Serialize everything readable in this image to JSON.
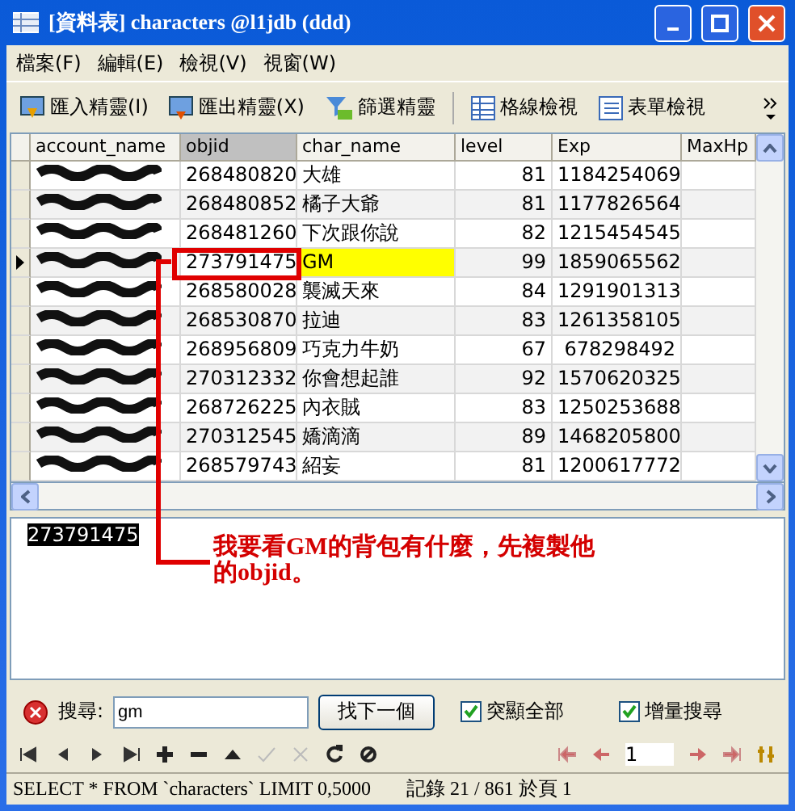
{
  "window": {
    "title": "[資料表] characters @l1jdb (ddd)"
  },
  "menu": [
    "檔案(F)",
    "編輯(E)",
    "檢視(V)",
    "視窗(W)"
  ],
  "toolbar": [
    {
      "label": "匯入精靈(I)",
      "kind": "import"
    },
    {
      "label": "匯出精靈(X)",
      "kind": "export"
    },
    {
      "label": "篩選精靈",
      "kind": "filter"
    },
    {
      "label": "格線檢視",
      "kind": "grid"
    },
    {
      "label": "表單檢視",
      "kind": "form"
    }
  ],
  "table": {
    "columns": [
      {
        "label": "account_name",
        "selected": false
      },
      {
        "label": "objid",
        "selected": true
      },
      {
        "label": "char_name",
        "selected": false
      },
      {
        "label": "level",
        "selected": false
      },
      {
        "label": "Exp",
        "selected": false
      },
      {
        "label": "MaxHp",
        "selected": false
      }
    ],
    "rows": [
      {
        "selected": false,
        "objid": "268480820",
        "char_name": "大雄",
        "level": "81",
        "exp": "1184254069",
        "match": false
      },
      {
        "selected": false,
        "objid": "268480852",
        "char_name": "橘子大爺",
        "level": "81",
        "exp": "1177826564",
        "match": false
      },
      {
        "selected": false,
        "objid": "268481260",
        "char_name": "下次跟你說",
        "level": "82",
        "exp": "1215454545",
        "match": false
      },
      {
        "selected": true,
        "objid": "273791475",
        "char_name": "GM",
        "level": "99",
        "exp": "1859065562",
        "match": true
      },
      {
        "selected": false,
        "objid": "268580028",
        "char_name": "襲滅天來",
        "level": "84",
        "exp": "1291901313",
        "match": false
      },
      {
        "selected": false,
        "objid": "268530870",
        "char_name": "拉迪",
        "level": "83",
        "exp": "1261358105",
        "match": false
      },
      {
        "selected": false,
        "objid": "268956809",
        "char_name": "巧克力牛奶",
        "level": "67",
        "exp": "678298492",
        "match": false
      },
      {
        "selected": false,
        "objid": "270312332",
        "char_name": "你會想起誰",
        "level": "92",
        "exp": "1570620325",
        "match": false
      },
      {
        "selected": false,
        "objid": "268726225",
        "char_name": "內衣賊",
        "level": "83",
        "exp": "1250253688",
        "match": false
      },
      {
        "selected": false,
        "objid": "270312545",
        "char_name": "嬌滴滴",
        "level": "89",
        "exp": "1468205800",
        "match": false
      },
      {
        "selected": false,
        "objid": "268579743",
        "char_name": "紹妄",
        "level": "81",
        "exp": "1200617772",
        "match": false
      }
    ]
  },
  "text_panel": {
    "value": "273791475"
  },
  "annotation": "我要看GM的背包有什麼，先複製他的objid。",
  "search": {
    "label": "搜尋:",
    "value": "gm",
    "button": "找下一個",
    "options": [
      {
        "label": "突顯全部",
        "checked": true
      },
      {
        "label": "增量搜尋",
        "checked": true
      }
    ]
  },
  "pager": {
    "page": "1"
  },
  "status_bar": {
    "query": "SELECT * FROM `characters` LIMIT 0,5000",
    "records": "記錄 21 / 861 於頁 1"
  }
}
